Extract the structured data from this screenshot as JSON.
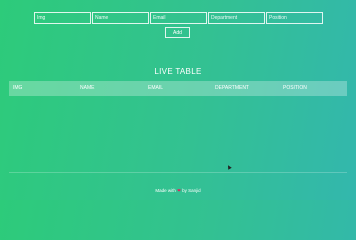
{
  "form": {
    "fields": [
      {
        "placeholder": "Img"
      },
      {
        "placeholder": "Name"
      },
      {
        "placeholder": "Email"
      },
      {
        "placeholder": "Department"
      },
      {
        "placeholder": "Position"
      }
    ],
    "add_label": "Add"
  },
  "table": {
    "title": "LIVE TABLE",
    "headers": [
      "IMG",
      "NAME",
      "EMAIL",
      "DEPARTMENT",
      "POSITION"
    ]
  },
  "footer": {
    "prefix": "Made with",
    "heart": "❤",
    "suffix": "by Sanjid"
  },
  "colors": {
    "gradient_start": "#2dcb7a",
    "gradient_end": "#33b7ad",
    "heart": "#e0245e"
  }
}
